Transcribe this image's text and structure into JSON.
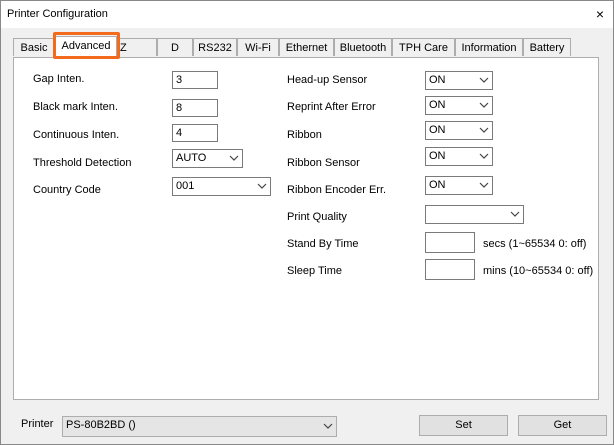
{
  "window": {
    "title": "Printer Configuration",
    "close_glyph": "×"
  },
  "tabs": [
    "Basic",
    "Advanced",
    "Z",
    "D",
    "RS232",
    "Wi-Fi",
    "Ethernet",
    "Bluetooth",
    "TPH Care",
    "Information",
    "Battery"
  ],
  "left": {
    "gap_label": "Gap Inten.",
    "gap_value": "3",
    "black_label": "Black mark Inten.",
    "black_value": "8",
    "cont_label": "Continuous Inten.",
    "cont_value": "4",
    "thresh_label": "Threshold Detection",
    "thresh_value": "AUTO",
    "country_label": "Country Code",
    "country_value": "001"
  },
  "right": {
    "headup_label": "Head-up Sensor",
    "headup_value": "ON",
    "reprint_label": "Reprint After Error",
    "reprint_value": "ON",
    "ribbon_label": "Ribbon",
    "ribbon_value": "ON",
    "ribbon_sensor_label": "Ribbon Sensor",
    "ribbon_sensor_value": "ON",
    "encoder_label": "Ribbon Encoder Err.",
    "encoder_value": "ON",
    "quality_label": "Print Quality",
    "quality_value": "",
    "standby_label": "Stand By Time",
    "standby_value": "",
    "standby_hint": "secs (1~65534 0: off)",
    "sleep_label": "Sleep Time",
    "sleep_value": "",
    "sleep_hint": "mins (10~65534 0: off)"
  },
  "bottom": {
    "printer_label": "Printer",
    "printer_value": "PS-80B2BD ()",
    "set_label": "Set",
    "get_label": "Get"
  },
  "accent": "#f36a1c"
}
